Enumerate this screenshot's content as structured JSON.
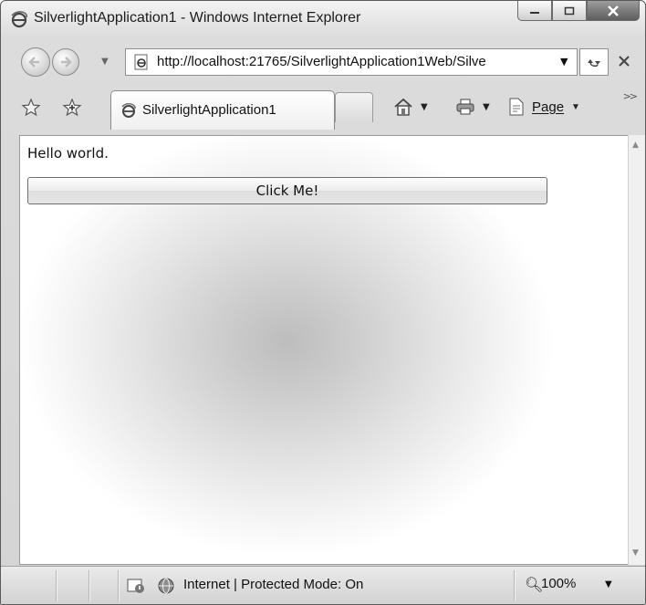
{
  "window": {
    "title": "SilverlightApplication1 - Windows Internet Explorer"
  },
  "address_bar": {
    "url": "http://localhost:21765/SilverlightApplication1Web/Silve"
  },
  "tabs": [
    {
      "label": "SilverlightApplication1"
    }
  ],
  "command_bar": {
    "page_label": "Page"
  },
  "content": {
    "greeting_text": "Hello world.",
    "button_label": "Click Me!"
  },
  "status_bar": {
    "zone_text": "Internet | Protected Mode: On",
    "zoom": "100%"
  },
  "colors": {
    "frame": "#d4d4d4",
    "radial_center": "#bdbdbd",
    "content_bg": "#ffffff"
  },
  "icons": [
    "ie-logo-icon",
    "minimize-icon",
    "maximize-icon",
    "close-icon",
    "back-icon",
    "forward-icon",
    "refresh-icon",
    "stop-icon",
    "favorites-star-icon",
    "add-favorite-icon",
    "home-icon",
    "print-icon",
    "page-icon",
    "protected-mode-icon",
    "globe-icon",
    "zoom-icon"
  ]
}
